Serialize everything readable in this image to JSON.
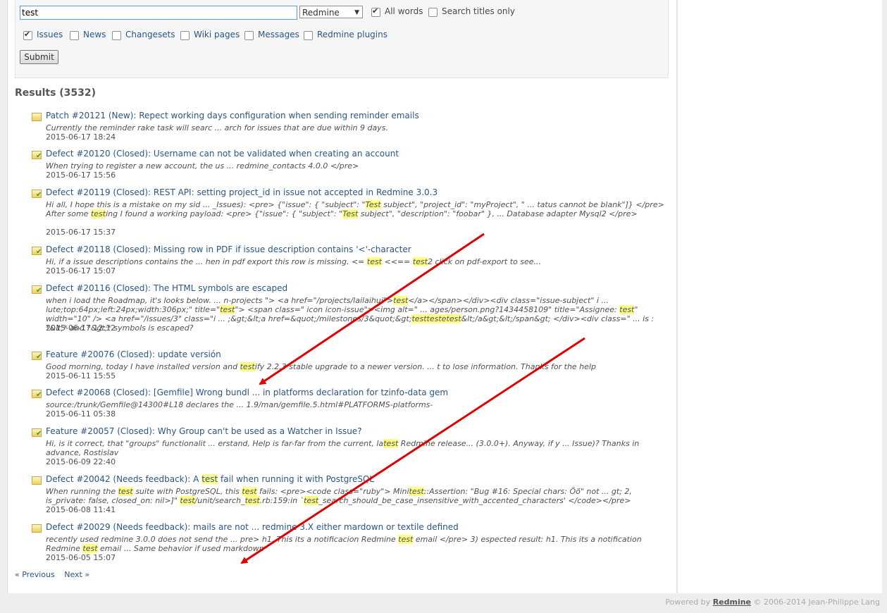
{
  "search": {
    "query": "test",
    "scope": "Redmine",
    "all_words_label": "All words",
    "all_words_checked": true,
    "titles_only_label": "Search titles only",
    "titles_only_checked": false,
    "types": [
      {
        "label": "Issues",
        "checked": true
      },
      {
        "label": "News",
        "checked": false
      },
      {
        "label": "Changesets",
        "checked": false
      },
      {
        "label": "Wiki pages",
        "checked": false
      },
      {
        "label": "Messages",
        "checked": false
      },
      {
        "label": "Redmine plugins",
        "checked": false
      }
    ],
    "submit_label": "Submit"
  },
  "results_title": "Results (3532)",
  "results": [
    {
      "title": "Patch #20121 (New): Repect working days configuration when sending reminder emails",
      "status": "open",
      "desc": [
        [
          "Currently the reminder rake task will searc ... arch for issues that are due within 9 days.",
          false
        ]
      ],
      "date": "2015-06-17 18:24"
    },
    {
      "title": "Defect #20120 (Closed): Username can not be validated when creating an account",
      "status": "closed",
      "desc": [
        [
          "When trying to register a new account, the us ... redmine_contacts 4.0.0 </pre>",
          false
        ]
      ],
      "date": "2015-06-17 15:56"
    },
    {
      "title": "Defect #20119 (Closed): REST API: setting project_id in issue not accepted in Redmine 3.0.3",
      "status": "closed",
      "desc": [
        [
          "Hi all, I hope this is a mistake on my sid ... _Issues): <pre> {\"issue\": { \"subject\": \"",
          false
        ],
        [
          "Test",
          true
        ],
        [
          " subject\", \"project_id\": \"myProject\", \" ... tatus cannot be blank\"]} </pre> After some ",
          false
        ],
        [
          "test",
          true
        ],
        [
          "ing I found a working payload: <pre> {\"issue\": { \"subject\": \"",
          false
        ],
        [
          "Test",
          true
        ],
        [
          " subject\", \"description\": \"foobar\" }, ... Database adapter Mysql2 </pre>",
          false
        ]
      ],
      "date": "2015-06-17 15:37"
    },
    {
      "title": "Defect #20118 (Closed): Missing row in PDF if issue description contains '<'-character",
      "status": "closed",
      "desc": [
        [
          "Hi, if a issue descriptions contains the ... hen in pdf export this row is missing. <= ",
          false
        ],
        [
          "test",
          true
        ],
        [
          " <<== ",
          false
        ],
        [
          "test",
          true
        ],
        [
          "2 click on pdf-export to see...",
          false
        ]
      ],
      "date": "2015-06-17 15:07"
    },
    {
      "title": "Defect #20116 (Closed): The HTML symbols are escaped",
      "status": "closed",
      "desc": [
        [
          "when i load the Roadmap, it's looks below. ... n-projects \"> <a href=\"/projects/lailaihui\">",
          false
        ],
        [
          "test",
          true
        ],
        [
          "</a></span></div><div class=\"issue-subject\" i ... lute;top:64px;left:24px;width:306px;\" title=\"",
          false
        ],
        [
          "test",
          true
        ],
        [
          "\"> <span class=\" icon icon-issue\"><img alt=\" ... ages/person.png?1434458109\" title=\"Assignee: ",
          false
        ],
        [
          "test",
          true
        ],
        [
          "\" width=\"10\" /> <a href=\"/issues/3\" class=\"i ... ;&gt;&lt;a href=&quot;/milestones/3&quot;&gt;",
          false
        ],
        [
          "testtestetest",
          true
        ],
        [
          "&lt;/a&gt;&lt;/span&gt; </div><div class=\" ... is : *&lt;* and *&gt;* symbols is escaped?",
          false
        ]
      ],
      "date": "2015-06-17 12:12"
    },
    {
      "title": "Feature #20076 (Closed): update versión",
      "status": "closed",
      "desc": [
        [
          "Good morning, today I have installed version and ",
          false
        ],
        [
          "test",
          true
        ],
        [
          "ify 2.2.3 stable upgrade to a newer version. ... t to lose information. Thanks for the help",
          false
        ]
      ],
      "date": "2015-06-11 15:55"
    },
    {
      "title": "Defect #20068 (Closed): [Gemfile] Wrong bundl ... in platforms declaration for tzinfo-data gem",
      "status": "closed",
      "desc": [
        [
          "source:/trunk/Gemfile@14300#L18 declares the ... 1.9/man/gemfile.5.html#PLATFORMS-platforms-",
          false
        ]
      ],
      "date": "2015-06-11 05:38"
    },
    {
      "title": "Feature #20057 (Closed): Why Group can't be used as a Watcher in Issue?",
      "status": "closed",
      "desc": [
        [
          "Hi, is it correct, that \"groups\" functionalit ... erstand, Help is far-far from the current, la",
          false
        ],
        [
          "test",
          true
        ],
        [
          " Redmine release... (3.0.0+). Anyway, if y ... Issue)? Thanks in advance, Rostislav",
          false
        ]
      ],
      "date": "2015-06-09 22:40"
    },
    {
      "title": "Defect #20042 (Needs feedback): A test fail when running it with PostgreSQL",
      "status": "open",
      "desc": [
        [
          "When running the ",
          false
        ],
        [
          "test",
          true
        ],
        [
          " suite with PostgreSQL, this ",
          false
        ],
        [
          "test",
          true
        ],
        [
          " fails: <pre><code class=\"ruby\"> Mini",
          false
        ],
        [
          "test",
          true
        ],
        [
          "::Assertion: \"Bug #16: Special chars: Öö\" not ... gt; 2, is_private: false, closed_on: nil>]\" ",
          false
        ],
        [
          "test",
          true
        ],
        [
          "/unit/search_",
          false
        ],
        [
          "test",
          true
        ],
        [
          ".rb:159:in `",
          false
        ],
        [
          "test",
          true
        ],
        [
          "_search_should_be_case_insensitive_with_accented_characters' </code></pre>",
          false
        ]
      ],
      "date": "2015-06-08 11:41"
    },
    {
      "title": "Defect #20029 (Needs feedback): mails are not ... redmine 3.X either mardown or textile defined",
      "status": "open",
      "desc": [
        [
          "recently used redmine 3.0.0 does not send the ... pre> h1. This its a notificacion Redmine ",
          false
        ],
        [
          "test",
          true
        ],
        [
          " email </pre> 3) espected result: h1. This its a notification Redmine ",
          false
        ],
        [
          "test",
          true
        ],
        [
          " email ... Same behavior if used markdown",
          false
        ]
      ],
      "date": "2015-06-05 15:07"
    }
  ],
  "pagination": {
    "prev": "« Previous",
    "next": "Next »"
  },
  "footer": {
    "prefix": "Powered by ",
    "link": "Redmine",
    "suffix": " © 2006-2014 Jean-Philippe Lang"
  }
}
